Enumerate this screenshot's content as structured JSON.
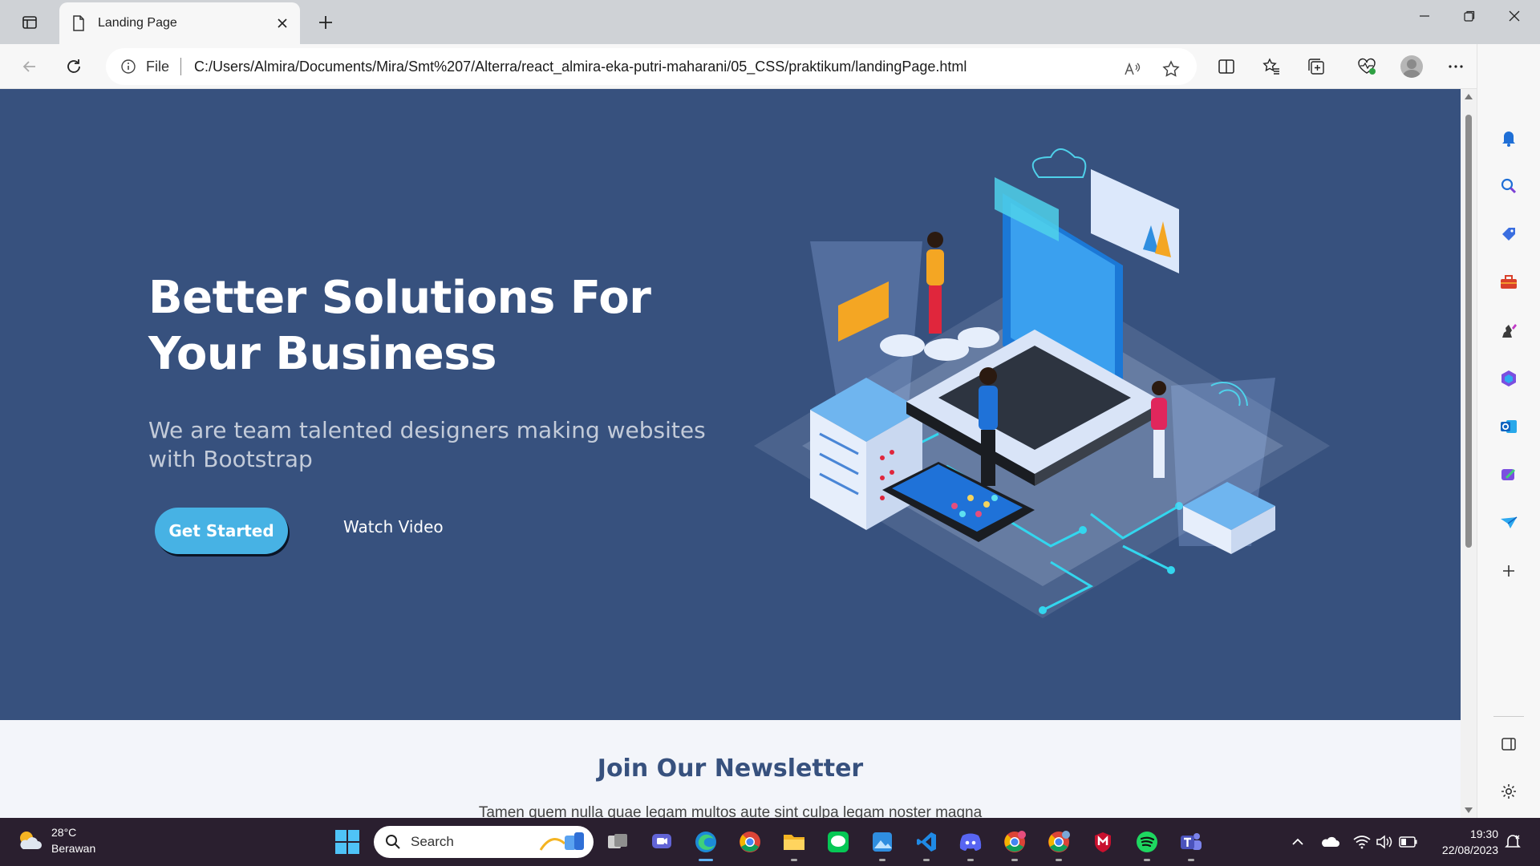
{
  "browser": {
    "tab_title": "Landing Page",
    "address_scheme": "File",
    "address_url": "C:/Users/Almira/Documents/Mira/Smt%207/Alterra/react_almira-eka-putri-maharani/05_CSS/praktikum/landingPage.html"
  },
  "hero": {
    "title": "Better Solutions For Your Business",
    "subtitle": "We are team talented designers making websites with Bootstrap",
    "get_started": "Get Started",
    "watch_video": "Watch Video"
  },
  "newsletter": {
    "title": "Join Our Newsletter",
    "text": "Tamen quem nulla quae legam multos aute sint culpa legam noster magna"
  },
  "taskbar": {
    "weather_temp": "28°C",
    "weather_desc": "Berawan",
    "search_label": "Search",
    "time": "19:30",
    "date": "22/08/2023"
  },
  "colors": {
    "hero_bg": "#37517e",
    "accent": "#47b2e4"
  }
}
